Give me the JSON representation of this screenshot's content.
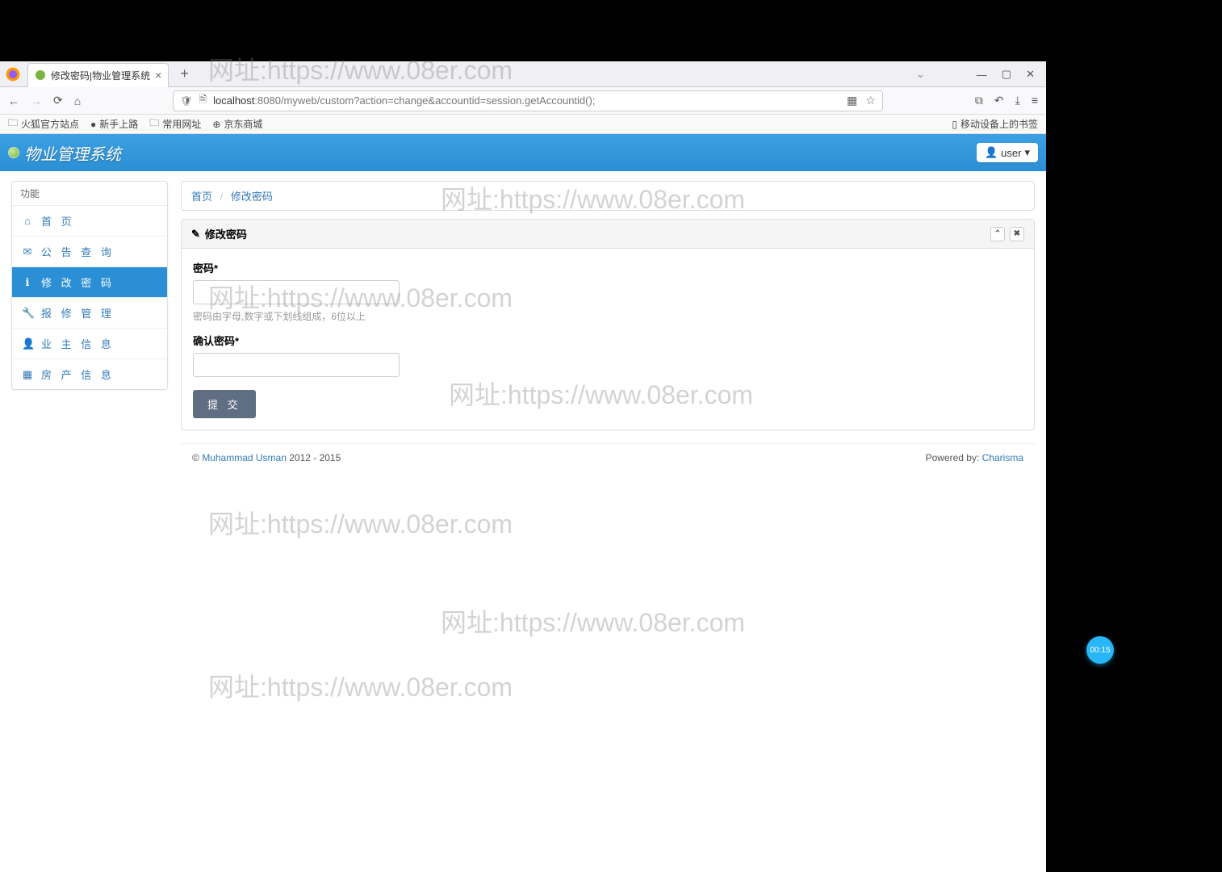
{
  "browser": {
    "tab_title": "修改密码|物业管理系统",
    "url_domain": "localhost",
    "url_rest": ":8080/myweb/custom?action=change&accountid=session.getAccountid();",
    "bookmarks": [
      "火狐官方站点",
      "新手上路",
      "常用网址",
      "京东商城"
    ],
    "bookmark_right": "移动设备上的书签"
  },
  "app": {
    "title": "物业管理系统",
    "user_label": "user"
  },
  "sidebar": {
    "header": "功能",
    "items": [
      {
        "icon": "home",
        "label": "首 页"
      },
      {
        "icon": "mail",
        "label": "公 告 查 询"
      },
      {
        "icon": "info",
        "label": "修 改 密 码"
      },
      {
        "icon": "wrench",
        "label": "报 修 管 理"
      },
      {
        "icon": "user",
        "label": "业 主 信 息"
      },
      {
        "icon": "grid",
        "label": "房 产 信 息"
      }
    ]
  },
  "breadcrumb": {
    "home": "首页",
    "current": "修改密码"
  },
  "panel": {
    "title": "修改密码",
    "pwd_label": "密码*",
    "pwd_hint": "密码由字母,数字或下划线组成，6位以上",
    "confirm_label": "确认密码*",
    "submit": "提 交"
  },
  "footer": {
    "copyright_prefix": "© ",
    "author": "Muhammad Usman",
    "years": " 2012 - 2015",
    "powered_label": "Powered by: ",
    "powered_by": "Charisma"
  },
  "watermark": "网址:https://www.08er.com",
  "timer": "00:15"
}
